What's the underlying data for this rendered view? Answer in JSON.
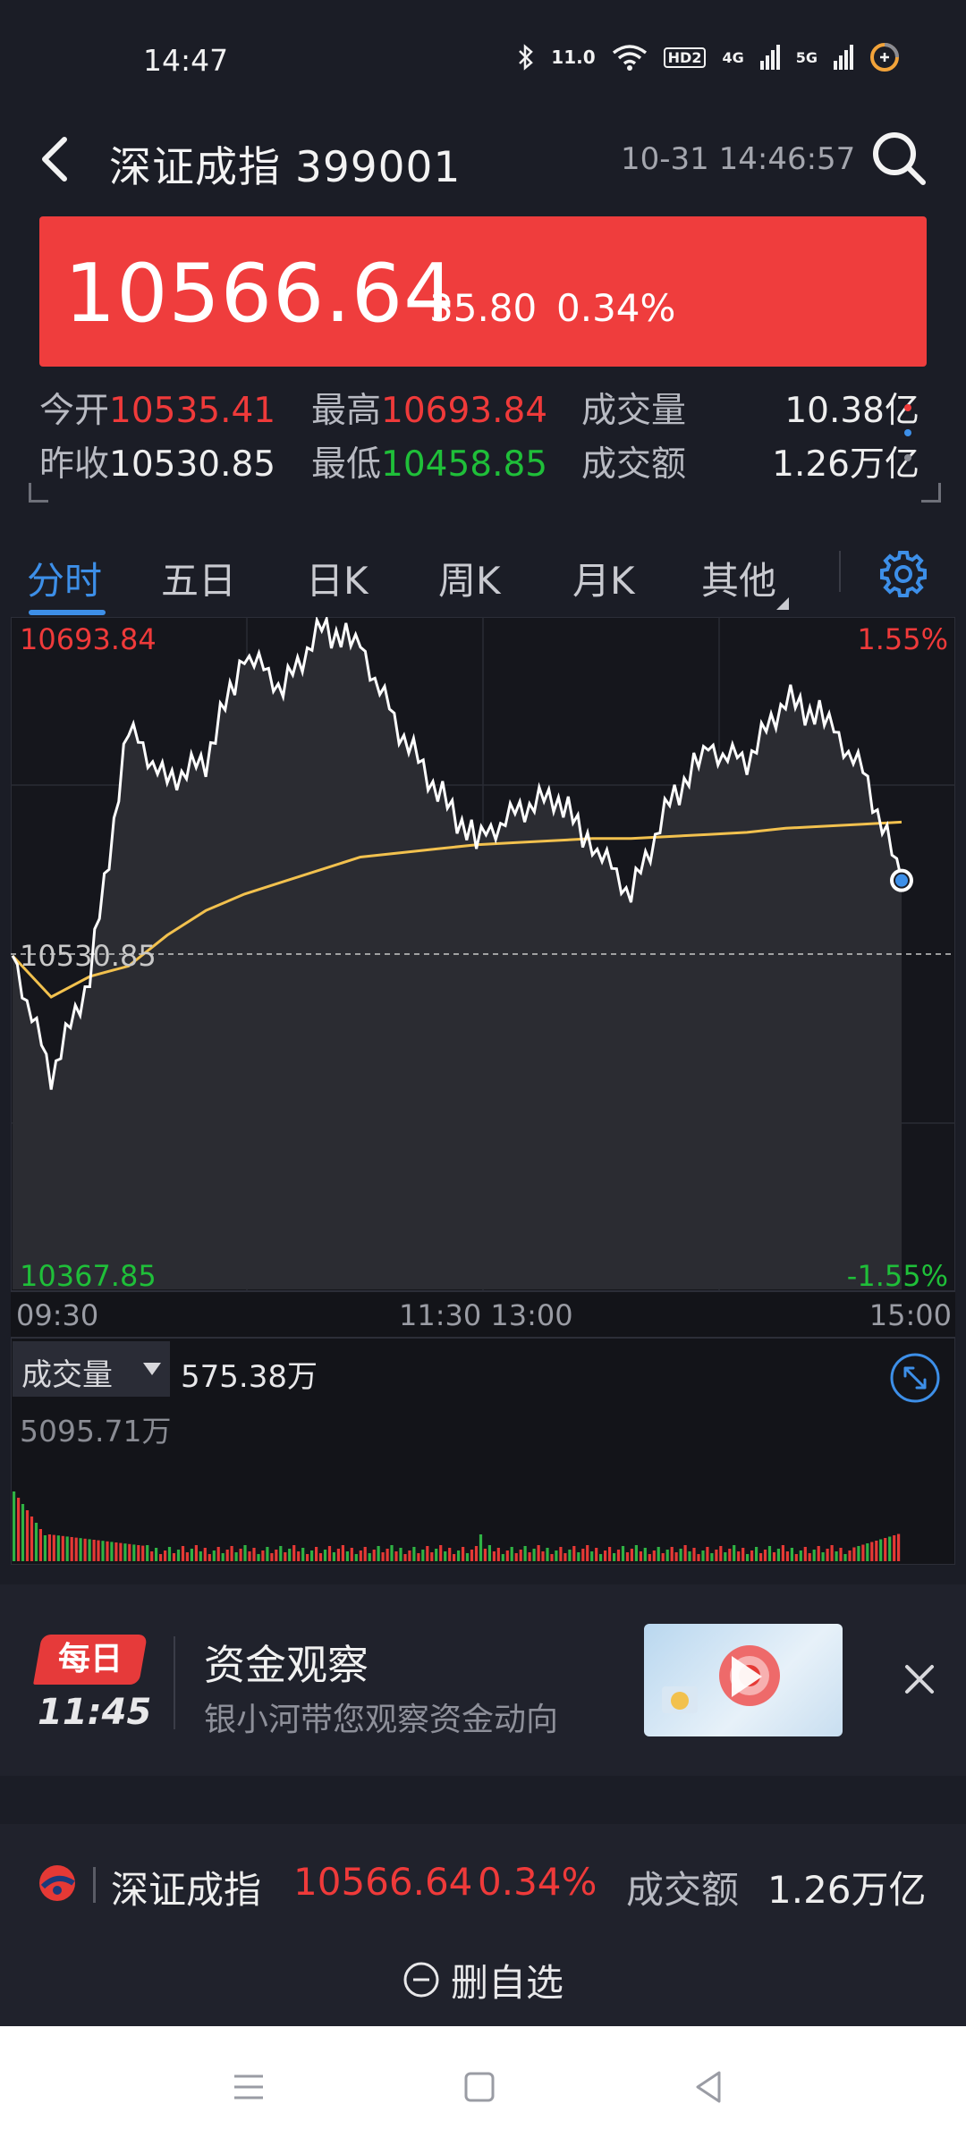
{
  "status": {
    "time": "14:47",
    "speed": "11.0",
    "hd": "HD2",
    "net1": "4G",
    "net2": "5G"
  },
  "header": {
    "title": "深证成指 399001",
    "datetime": "10-31 14:46:57"
  },
  "quote": {
    "price": "10566.64",
    "change": "35.80",
    "change_pct": "0.34%"
  },
  "stats": {
    "open_label": "今开",
    "open": "10535.41",
    "high_label": "最高",
    "high": "10693.84",
    "volume_label": "成交量",
    "volume": "10.38亿",
    "prev_label": "昨收",
    "prev": "10530.85",
    "low_label": "最低",
    "low": "10458.85",
    "amount_label": "成交额",
    "amount": "1.26万亿"
  },
  "tabs": [
    "分时",
    "五日",
    "日K",
    "周K",
    "月K",
    "其他"
  ],
  "chart": {
    "max_label": "10693.84",
    "max_pct": "1.55%",
    "mid_label": "10530.85",
    "min_label": "10367.85",
    "min_pct": "-1.55%",
    "time_start": "09:30",
    "time_mid": "11:30 13:00",
    "time_end": "15:00",
    "volume_label": "成交量",
    "volume_value": "575.38万",
    "volume_max": "5095.71万",
    "colors": {
      "price_line": "#ffffff",
      "avg_line": "#f2c14e",
      "up": "#e53935",
      "down": "#2fb344",
      "marker": "#3d8fe8"
    }
  },
  "chart_data": {
    "type": "line",
    "title": "",
    "xlabel": "",
    "ylabel": "",
    "x": [
      "09:30",
      "09:40",
      "09:50",
      "10:00",
      "10:10",
      "10:20",
      "10:30",
      "10:40",
      "10:50",
      "11:00",
      "11:10",
      "11:20",
      "11:30",
      "13:10",
      "13:20",
      "13:30",
      "13:40",
      "13:50",
      "14:00",
      "14:10",
      "14:20",
      "14:30",
      "14:40",
      "14:46"
    ],
    "ylim": [
      10367.85,
      10693.84
    ],
    "series": [
      {
        "name": "",
        "values": [
          10530,
          10472,
          10520,
          10640,
          10615,
          10625,
          10678,
          10660,
          10690,
          10680,
          10640,
          10610,
          10585,
          10600,
          10608,
          10585,
          10560,
          10605,
          10630,
          10625,
          10655,
          10645,
          10620,
          10566.64
        ]
      },
      {
        "name": "",
        "values": [
          10530,
          10510,
          10520,
          10525,
          10540,
          10552,
          10560,
          10566,
          10572,
          10578,
          10580,
          10582,
          10584,
          10585,
          10586,
          10587,
          10587,
          10588,
          10589,
          10590,
          10592,
          10593,
          10594,
          10595
        ]
      }
    ]
  },
  "promo": {
    "badge": "每日",
    "time": "11:45",
    "title": "资金观察",
    "subtitle": "银小河带您观察资金动向"
  },
  "bottom": {
    "name": "深证成指",
    "price": "10566.64",
    "pct": "0.34%",
    "amount_label": "成交额",
    "amount": "1.26万亿",
    "delete_label": "删自选"
  }
}
